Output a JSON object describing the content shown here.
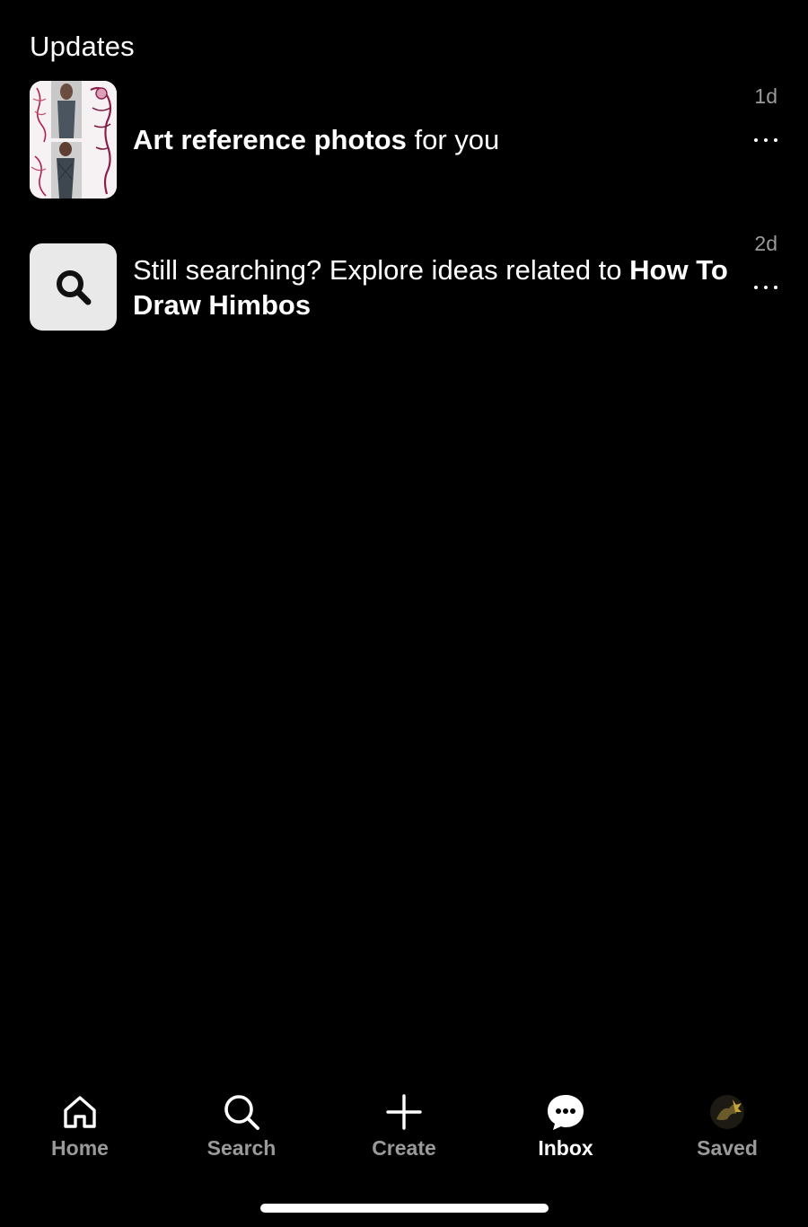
{
  "updates_section": {
    "title": "Updates"
  },
  "updates": [
    {
      "bold_text": "Art reference photos",
      "normal_text": " for you",
      "time": "1d",
      "thumbnail_icon": "art-reference-collage-thumbnail"
    },
    {
      "normal_text": "Still searching? Explore ideas related to ",
      "bold_text": "How To Draw Himbos",
      "time": "2d",
      "thumbnail_icon": "search-icon"
    }
  ],
  "tabbar": {
    "home": {
      "label": "Home",
      "icon": "home-icon"
    },
    "search": {
      "label": "Search",
      "icon": "search-icon"
    },
    "create": {
      "label": "Create",
      "icon": "plus-icon"
    },
    "inbox": {
      "label": "Inbox",
      "icon": "chat-bubble-icon",
      "active": true
    },
    "saved": {
      "label": "Saved",
      "icon": "profile-avatar"
    }
  },
  "colors": {
    "background": "#000000",
    "text_primary": "#ffffff",
    "text_secondary": "#9a9a9a",
    "search_tile": "#e9e9e9"
  }
}
